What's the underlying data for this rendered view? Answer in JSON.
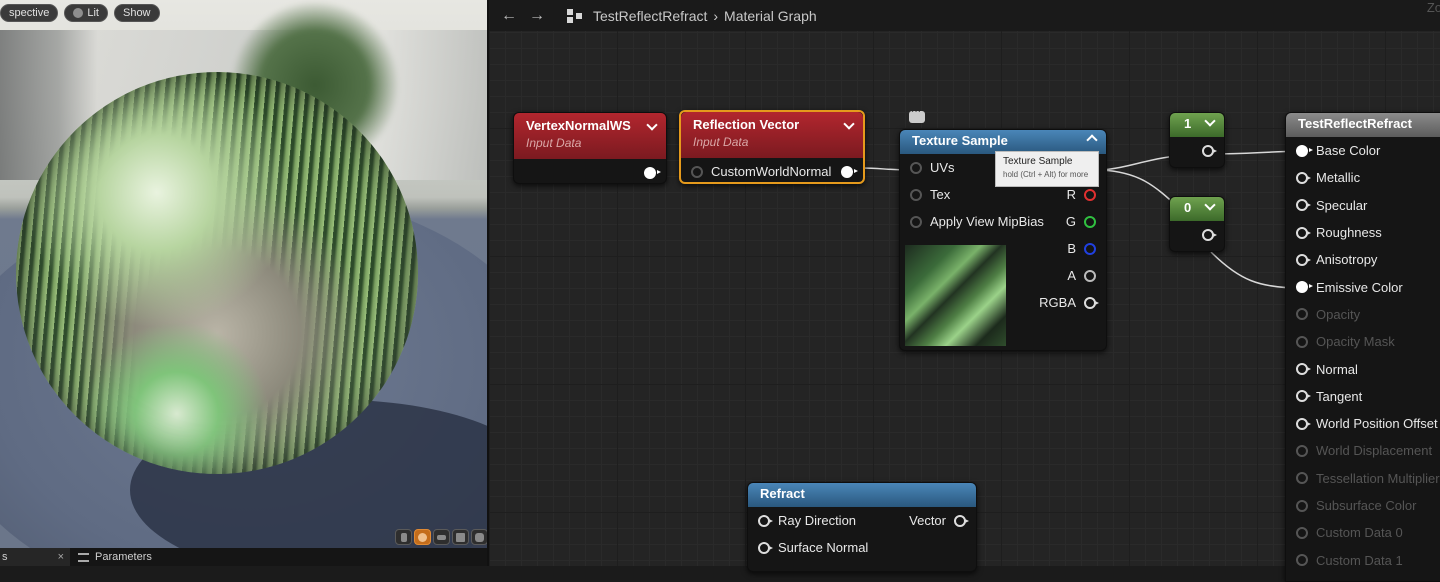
{
  "viewport": {
    "pills": [
      {
        "label": "spective",
        "icon": ""
      },
      {
        "label": "Lit",
        "icon": "lit-icon"
      },
      {
        "label": "Show",
        "icon": ""
      }
    ]
  },
  "bottom_tabs": {
    "first": {
      "label": "s",
      "close": "×"
    },
    "second": {
      "label": "Parameters",
      "icon": "parameters-icon"
    }
  },
  "toolbar": {
    "back": "←",
    "forward": "→",
    "asset_name": "TestReflectRefract",
    "separator": "›",
    "graph_name": "Material Graph",
    "zoom_label": "Zo"
  },
  "nodes": {
    "vertex": {
      "title": "VertexNormalWS",
      "subtitle": "Input Data"
    },
    "reflection": {
      "title": "Reflection Vector",
      "subtitle": "Input Data",
      "input": "CustomWorldNormal"
    },
    "texture": {
      "title": "Texture Sample",
      "inputs": [
        "UVs",
        "Tex",
        "Apply View MipBias"
      ],
      "outputs": [
        "R",
        "G",
        "B",
        "A",
        "RGBA"
      ],
      "tooltip": {
        "title": "Texture Sample",
        "hint": "hold (Ctrl + Alt) for more"
      }
    },
    "const_one": {
      "value": "1"
    },
    "const_zero": {
      "value": "0"
    },
    "refract": {
      "title": "Refract",
      "inputs": [
        "Ray Direction",
        "Surface Normal"
      ],
      "output": "Vector"
    },
    "result": {
      "title": "TestReflectRefract",
      "pins": [
        {
          "label": "Base Color",
          "active": true
        },
        {
          "label": "Metallic",
          "active": true
        },
        {
          "label": "Specular",
          "active": true
        },
        {
          "label": "Roughness",
          "active": true
        },
        {
          "label": "Anisotropy",
          "active": true
        },
        {
          "label": "Emissive Color",
          "active": true
        },
        {
          "label": "Opacity",
          "active": false
        },
        {
          "label": "Opacity Mask",
          "active": false
        },
        {
          "label": "Normal",
          "active": true
        },
        {
          "label": "Tangent",
          "active": true
        },
        {
          "label": "World Position Offset",
          "active": true
        },
        {
          "label": "World Displacement",
          "active": false
        },
        {
          "label": "Tessellation Multiplier",
          "active": false
        },
        {
          "label": "Subsurface Color",
          "active": false
        },
        {
          "label": "Custom Data 0",
          "active": false
        },
        {
          "label": "Custom Data 1",
          "active": false
        }
      ]
    }
  },
  "colors": {
    "selection": "#e59a1c",
    "input_header": "#b2262e",
    "texture_header": "#4a86b8",
    "constant_header": "#6fa24f"
  }
}
